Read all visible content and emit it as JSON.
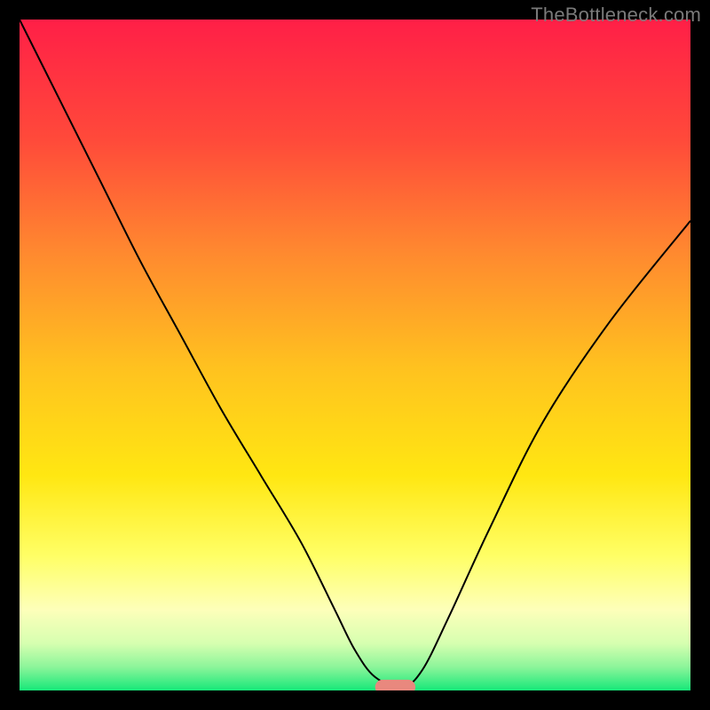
{
  "watermark": "TheBottleneck.com",
  "chart_data": {
    "type": "line",
    "title": "",
    "xlabel": "",
    "ylabel": "",
    "xlim": [
      0,
      100
    ],
    "ylim": [
      0,
      100
    ],
    "grid": false,
    "legend": false,
    "gradient_stops": [
      {
        "offset": 0.0,
        "color": "#ff1f47"
      },
      {
        "offset": 0.18,
        "color": "#ff4a3a"
      },
      {
        "offset": 0.35,
        "color": "#ff8a2f"
      },
      {
        "offset": 0.52,
        "color": "#ffc21f"
      },
      {
        "offset": 0.68,
        "color": "#ffe712"
      },
      {
        "offset": 0.8,
        "color": "#ffff66"
      },
      {
        "offset": 0.88,
        "color": "#fdffba"
      },
      {
        "offset": 0.93,
        "color": "#d6ffb0"
      },
      {
        "offset": 0.965,
        "color": "#8cf59a"
      },
      {
        "offset": 1.0,
        "color": "#17e879"
      }
    ],
    "series": [
      {
        "name": "bottleneck-curve",
        "color": "#000000",
        "stroke_width": 2,
        "x": [
          0,
          6,
          12,
          18,
          24,
          30,
          36,
          42,
          47,
          50,
          53,
          57,
          60,
          64,
          70,
          78,
          88,
          100
        ],
        "values": [
          100,
          88,
          76,
          64,
          53,
          42,
          32,
          22,
          12,
          6,
          2,
          0.5,
          3,
          11,
          24,
          40,
          55,
          70
        ]
      }
    ],
    "marker": {
      "name": "optimal-marker",
      "x": 56,
      "y": 0.5,
      "width": 6,
      "height": 2.2,
      "color": "#e9887e"
    }
  }
}
